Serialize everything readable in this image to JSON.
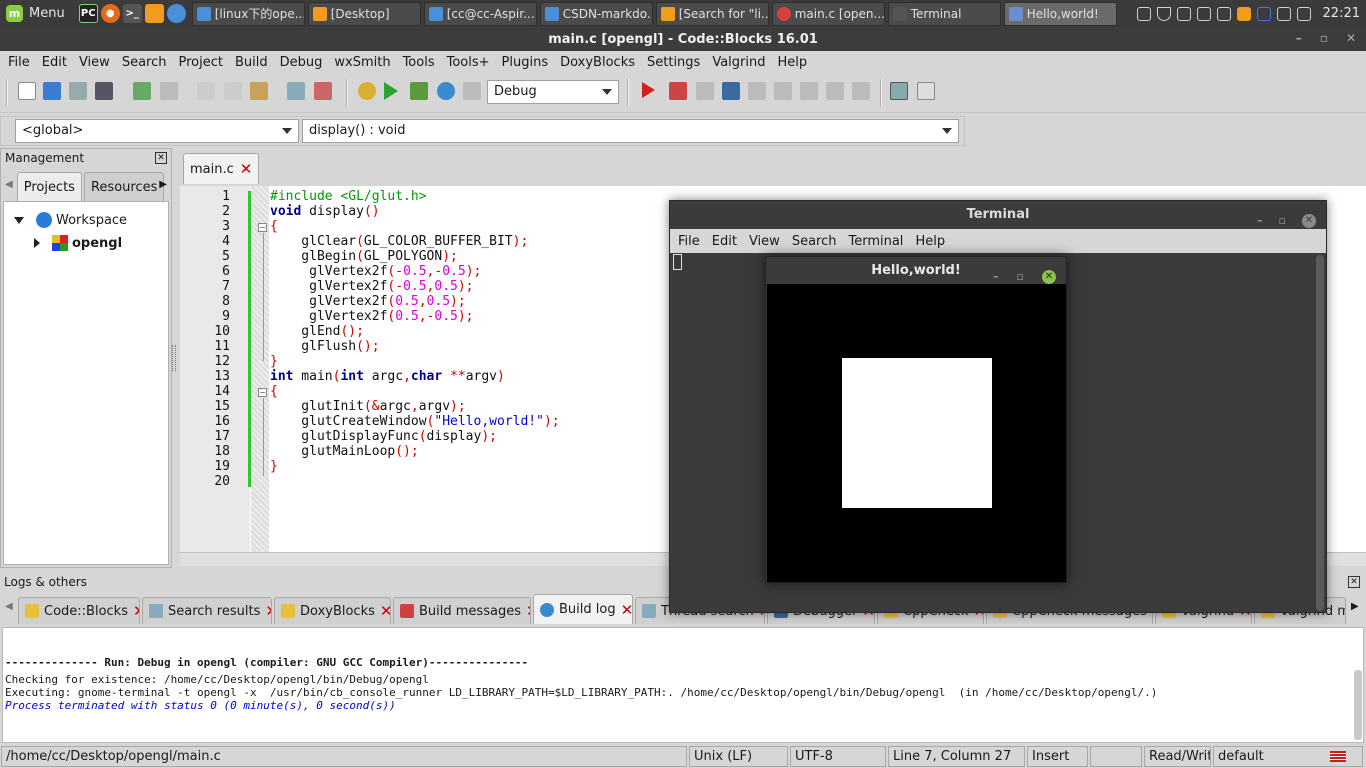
{
  "panel": {
    "menu_label": "Menu",
    "tasks": [
      {
        "label": "[linux下的ope...",
        "color": "#4a90d9"
      },
      {
        "label": "[Desktop]",
        "color": "#f29c1f"
      },
      {
        "label": "[cc@cc-Aspir...",
        "color": "#4a90d9"
      },
      {
        "label": "CSDN-markdo...",
        "color": "#4a90d9"
      },
      {
        "label": "[Search for \"li...",
        "color": "#f29c1f"
      },
      {
        "label": "main.c [open...",
        "color": "#d93f3f"
      },
      {
        "label": "Terminal",
        "color": "#555555"
      },
      {
        "label": "Hello,world!",
        "color": "#6a8ecf"
      }
    ],
    "clock": "22:21"
  },
  "window": {
    "title": "main.c [opengl] - Code::Blocks 16.01"
  },
  "menubar": [
    "File",
    "Edit",
    "View",
    "Search",
    "Project",
    "Build",
    "Debug",
    "wxSmith",
    "Tools",
    "Tools+",
    "Plugins",
    "DoxyBlocks",
    "Settings",
    "Valgrind",
    "Help"
  ],
  "toolbar": {
    "build_target": "Debug"
  },
  "scope": {
    "scope_value": "<global>",
    "function_value": "display() : void"
  },
  "management": {
    "title": "Management",
    "tabs": [
      "Projects",
      "Resources"
    ],
    "workspace_label": "Workspace",
    "project_label": "opengl"
  },
  "editor": {
    "tab_label": "main.c",
    "line_numbers": [
      "1",
      "2",
      "3",
      "4",
      "5",
      "6",
      "7",
      "8",
      "9",
      "10",
      "11",
      "12",
      "13",
      "14",
      "15",
      "16",
      "17",
      "18",
      "19",
      "20"
    ]
  },
  "logs": {
    "title": "Logs & others",
    "tabs": [
      "Code::Blocks",
      "Search results",
      "DoxyBlocks",
      "Build messages",
      "Build log",
      "Thread search",
      "Debugger",
      "CppCheck",
      "CppCheck messages",
      "Valgrind",
      "Valgrind me"
    ],
    "lines": [
      "-------------- Run: Debug in opengl (compiler: GNU GCC Compiler)---------------",
      "Checking for existence: /home/cc/Desktop/opengl/bin/Debug/opengl",
      "Executing: gnome-terminal -t opengl -x  /usr/bin/cb_console_runner LD_LIBRARY_PATH=$LD_LIBRARY_PATH:. /home/cc/Desktop/opengl/bin/Debug/opengl  (in /home/cc/Desktop/opengl/.)",
      "Process terminated with status 0 (0 minute(s), 0 second(s))"
    ]
  },
  "status": {
    "path": "/home/cc/Desktop/opengl/main.c",
    "eol": "Unix (LF)",
    "encoding": "UTF-8",
    "position": "Line 7, Column 27",
    "mode": "Insert",
    "access": "Read/Write",
    "keymap": "default"
  },
  "terminal": {
    "title": "Terminal",
    "menu": [
      "File",
      "Edit",
      "View",
      "Search",
      "Terminal",
      "Help"
    ]
  },
  "hello": {
    "title": "Hello,world!"
  }
}
